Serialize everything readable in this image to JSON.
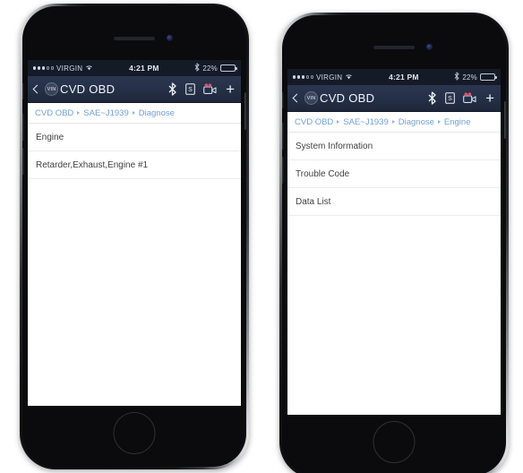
{
  "colors": {
    "navbar_top": "#2b3550",
    "navbar_bottom": "#1e2739",
    "statusbar": "#151a27",
    "breadcrumb_link": "#6f9fd8",
    "row_text": "#3f3f3f",
    "screen_bg": "#ffffff",
    "camera_icon_accent": "#e0516f",
    "page_bg": "#ffffff"
  },
  "phones": [
    {
      "id": "phone-left",
      "status_bar": {
        "carrier": "VIRGIN",
        "signal_dots_filled": 3,
        "signal_dots_hollow": 2,
        "wifi_icon": "wifi-icon",
        "time": "4:21 PM",
        "bluetooth_icon": "bluetooth-icon",
        "battery_percent": "22%",
        "battery_level": 22
      },
      "navbar": {
        "back_icon": "chevron-left-icon",
        "vin_badge": "VIN",
        "title": "CVD OBD",
        "actions": [
          {
            "name": "bluetooth-icon",
            "label": "Bluetooth"
          },
          {
            "name": "screenshot-icon",
            "label": "S"
          },
          {
            "name": "video-camera-icon",
            "label": "Record"
          },
          {
            "name": "plus-icon",
            "label": "+"
          }
        ]
      },
      "breadcrumb": [
        "CVD OBD",
        "SAE~J1939",
        "Diagnose"
      ],
      "list": [
        "Engine",
        "Retarder,Exhaust,Engine #1"
      ]
    },
    {
      "id": "phone-right",
      "status_bar": {
        "carrier": "VIRGIN",
        "signal_dots_filled": 3,
        "signal_dots_hollow": 2,
        "wifi_icon": "wifi-icon",
        "time": "4:21 PM",
        "bluetooth_icon": "bluetooth-icon",
        "battery_percent": "22%",
        "battery_level": 22
      },
      "navbar": {
        "back_icon": "chevron-left-icon",
        "vin_badge": "VIN",
        "title": "CVD OBD",
        "actions": [
          {
            "name": "bluetooth-icon",
            "label": "Bluetooth"
          },
          {
            "name": "screenshot-icon",
            "label": "S"
          },
          {
            "name": "video-camera-icon",
            "label": "Record"
          },
          {
            "name": "plus-icon",
            "label": "+"
          }
        ]
      },
      "breadcrumb": [
        "CVD OBD",
        "SAE~J1939",
        "Diagnose",
        "Engine"
      ],
      "list": [
        "System Information",
        "Trouble Code",
        "Data List"
      ]
    }
  ]
}
